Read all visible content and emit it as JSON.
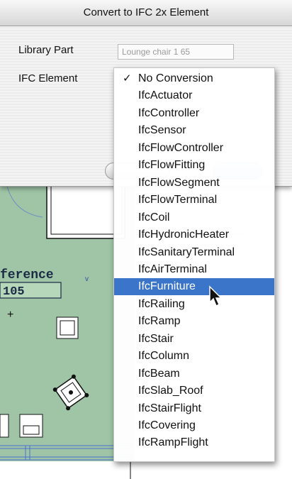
{
  "dialog": {
    "title": "Convert to IFC 2x Element",
    "library_part_label": "Library Part",
    "library_part_value": "Lounge chair 1 65",
    "ifc_element_label": "IFC Element"
  },
  "plan": {
    "room_name": "ference",
    "room_number": "105"
  },
  "menu": {
    "checkmark": "✓",
    "items": [
      {
        "label": "No Conversion"
      },
      {
        "label": "IfcActuator"
      },
      {
        "label": "IfcController"
      },
      {
        "label": "IfcSensor"
      },
      {
        "label": "IfcFlowController"
      },
      {
        "label": "IfcFlowFitting"
      },
      {
        "label": "IfcFlowSegment"
      },
      {
        "label": "IfcFlowTerminal"
      },
      {
        "label": "IfcCoil"
      },
      {
        "label": "IfcHydronicHeater"
      },
      {
        "label": "IfcSanitaryTerminal"
      },
      {
        "label": "IfcAirTerminal"
      },
      {
        "label": "IfcFurniture"
      },
      {
        "label": "IfcRailing"
      },
      {
        "label": "IfcRamp"
      },
      {
        "label": "IfcStair"
      },
      {
        "label": "IfcColumn"
      },
      {
        "label": "IfcBeam"
      },
      {
        "label": "IfcSlab_Roof"
      },
      {
        "label": "IfcStairFlight"
      },
      {
        "label": "IfcCovering"
      },
      {
        "label": "IfcRampFlight"
      }
    ],
    "checked_index": 0,
    "highlighted_index": 12
  },
  "colors": {
    "plan_fill": "#9fc5a6",
    "highlight": "#3a75c9"
  }
}
